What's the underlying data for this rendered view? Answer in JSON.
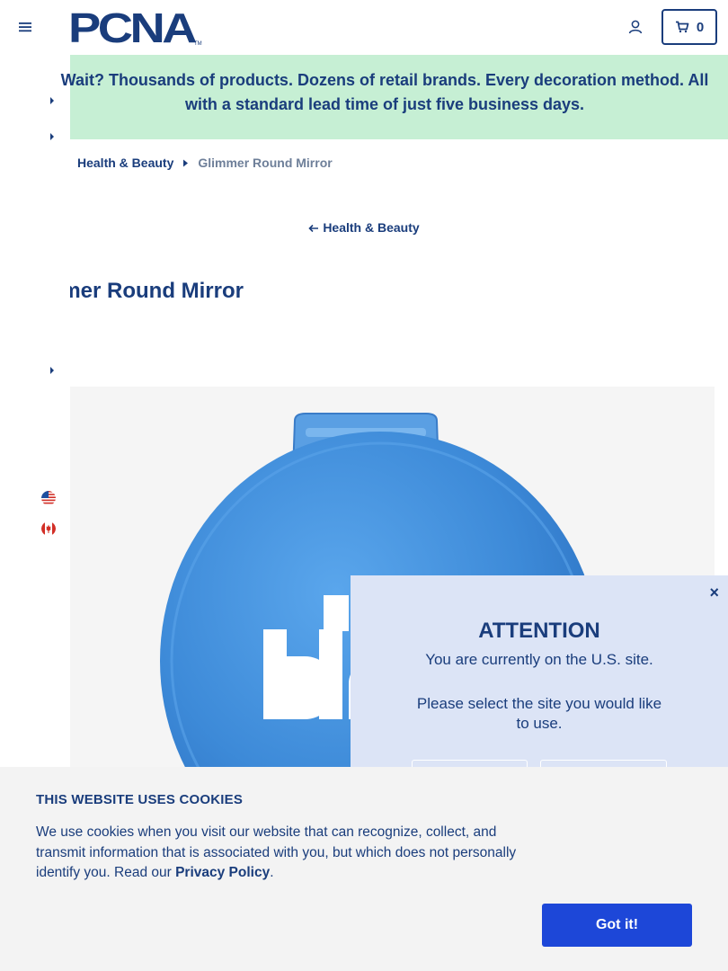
{
  "header": {
    "logo_text": "PCNA",
    "cart_count": "0"
  },
  "promo": {
    "text": "Wait? Thousands of products. Dozens of retail brands. Every decoration method. All with a standard lead time of just five business days."
  },
  "breadcrumb": {
    "category": "Health & Beauty",
    "current": "Glimmer Round Mirror"
  },
  "back_link": {
    "label": "Health & Beauty"
  },
  "product": {
    "title": "Glimmer Round Mirror",
    "image_print": "nn blac"
  },
  "country_modal": {
    "close_symbol": "×",
    "title": "ATTENTION",
    "line1": "You are currently on the U.S. site.",
    "line2": "Please select the site you would like to use."
  },
  "cookies": {
    "title": "THIS WEBSITE USES COOKIES",
    "body_before": "We use cookies when you visit our website that can recognize, collect, and transmit information that is associated with you, but which does not personally identify you. Read our ",
    "privacy_link": "Privacy Policy",
    "body_after": ".",
    "accept_label": "Got it!"
  },
  "colors": {
    "navy": "#1a3d7c",
    "promo_bg": "#c6efd4",
    "modal_bg": "#dce4f6",
    "cookie_button": "#1d47d8",
    "mirror_blue": "#3d8ad8"
  },
  "icons": [
    "menu-icon",
    "user-icon",
    "cart-icon",
    "caret-right-icon",
    "arrow-left-icon",
    "us-flag-icon",
    "canada-flag-icon",
    "close-icon"
  ]
}
